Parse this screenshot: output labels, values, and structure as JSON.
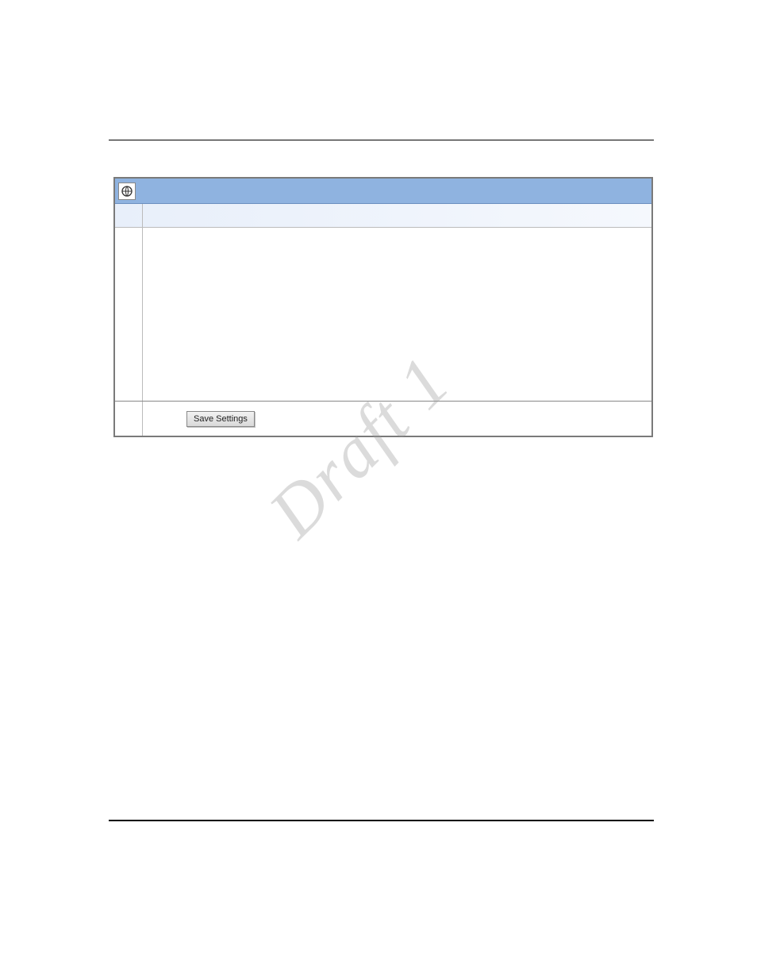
{
  "watermark": "Draft 1",
  "dialog": {
    "save_button_label": "Save Settings"
  }
}
